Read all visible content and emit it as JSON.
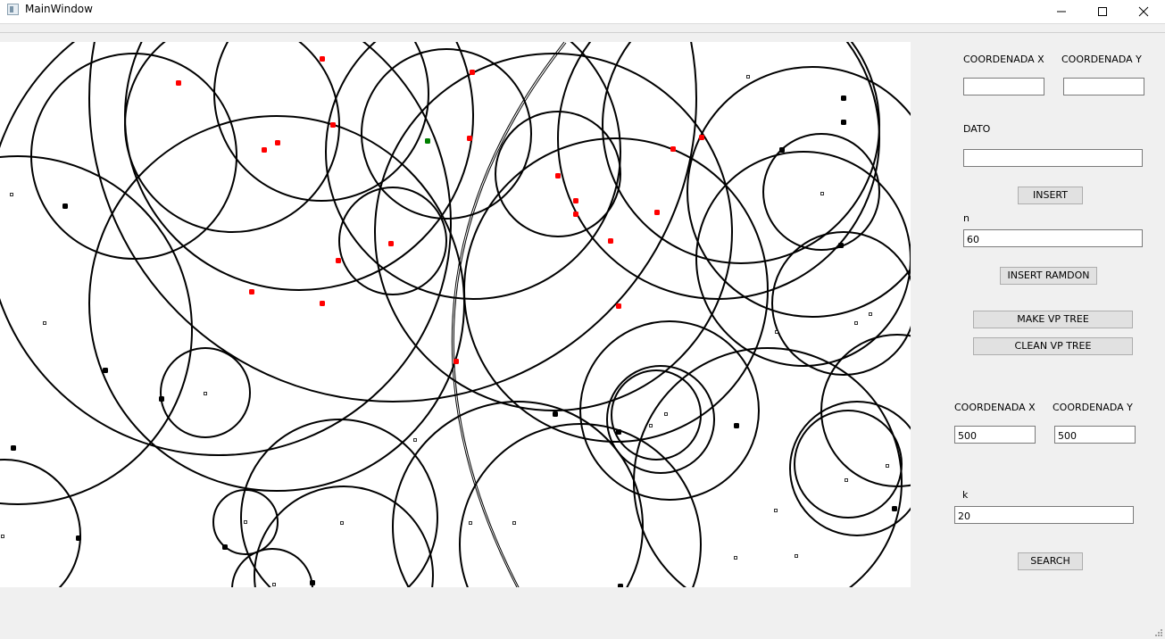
{
  "window": {
    "title": "MainWindow",
    "controls": {
      "minimize": "minimize-icon",
      "maximize": "maximize-icon",
      "close": "close-icon"
    }
  },
  "canvas": {
    "background": "#ffffff",
    "point_colors": {
      "highlighted": "#ff0000",
      "query": "#008000",
      "normal": "#000000"
    }
  },
  "panel": {
    "insert": {
      "x_label": "COORDENADA X",
      "y_label": "COORDENADA Y",
      "x_value": "",
      "y_value": "",
      "dato_label": "DATO",
      "dato_value": "",
      "insert_button": "INSERT"
    },
    "random": {
      "n_label": "n",
      "n_value": "60",
      "insert_random_button": "INSERT RAMDON"
    },
    "tree": {
      "make_button": "MAKE VP TREE",
      "clean_button": "CLEAN VP TREE"
    },
    "search": {
      "x_label": "COORDENADA X",
      "y_label": "COORDENADA Y",
      "x_value": "500",
      "y_value": "500",
      "k_label": "k",
      "k_value": "20",
      "search_button": "SEARCH"
    }
  }
}
